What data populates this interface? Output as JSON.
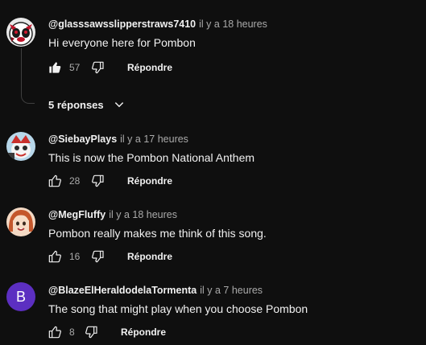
{
  "comments": [
    {
      "handle": "@glasssawsslipperstraws7410",
      "time": "il y a 18 heures",
      "text": "Hi everyone here for Pombon",
      "likes": "57",
      "liked": true,
      "reply_label": "Répondre",
      "avatar_icon": "panda-mascot-avatar",
      "replies_label": "5 réponses"
    },
    {
      "handle": "@SiebayPlays",
      "time": "il y a 17 heures",
      "text": "This is now the Pombon National Anthem",
      "likes": "28",
      "liked": false,
      "reply_label": "Répondre",
      "avatar_icon": "cartoon-character-avatar"
    },
    {
      "handle": "@MegFluffy",
      "time": "il y a 18 heures",
      "text": "Pombon really makes me think of this song.",
      "likes": "16",
      "liked": false,
      "reply_label": "Répondre",
      "avatar_icon": "red-haired-girl-avatar"
    },
    {
      "handle": "@BlazeElHeraldodelaTormenta",
      "time": "il y a 7 heures",
      "text": "The song that might play when you choose Pombon",
      "likes": "8",
      "liked": false,
      "reply_label": "Répondre",
      "avatar_letter": "B",
      "avatar_color": "#5c2fc1"
    }
  ]
}
